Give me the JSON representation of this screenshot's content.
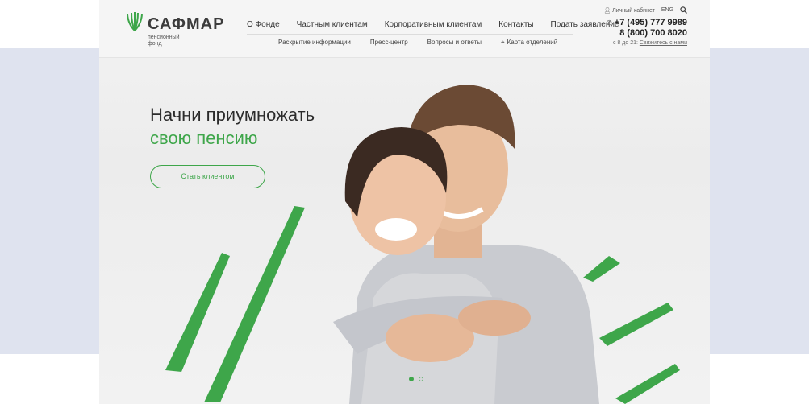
{
  "logo": {
    "name": "САФМАР",
    "subtitle_line1": "пенсионный",
    "subtitle_line2": "фонд"
  },
  "nav_main": [
    "О Фонде",
    "Частным клиентам",
    "Корпоративным клиентам",
    "Контакты",
    "Подать заявление"
  ],
  "nav_sub": [
    "Раскрытие информации",
    "Пресс-центр",
    "Вопросы и ответы"
  ],
  "nav_map": "Карта отделений",
  "utility": {
    "cabinet": "Личный кабинет",
    "lang": "ENG"
  },
  "phones": [
    "+7 (495) 777 9989",
    "8 (800) 700 8020"
  ],
  "hours": {
    "prefix": "с 8 до 21:",
    "link": "Свяжитесь с нами"
  },
  "hero": {
    "line1": "Начни приумножать",
    "line2": "свою пенсию",
    "cta": "Стать клиентом"
  },
  "slider": {
    "current": 1,
    "total": 2
  },
  "colors": {
    "brand_green": "#3ea64a",
    "band": "#dfe3ef"
  },
  "icons": [
    "user-icon",
    "search-icon",
    "phone-icon",
    "map-pin-icon",
    "logo-leaf-icon"
  ]
}
